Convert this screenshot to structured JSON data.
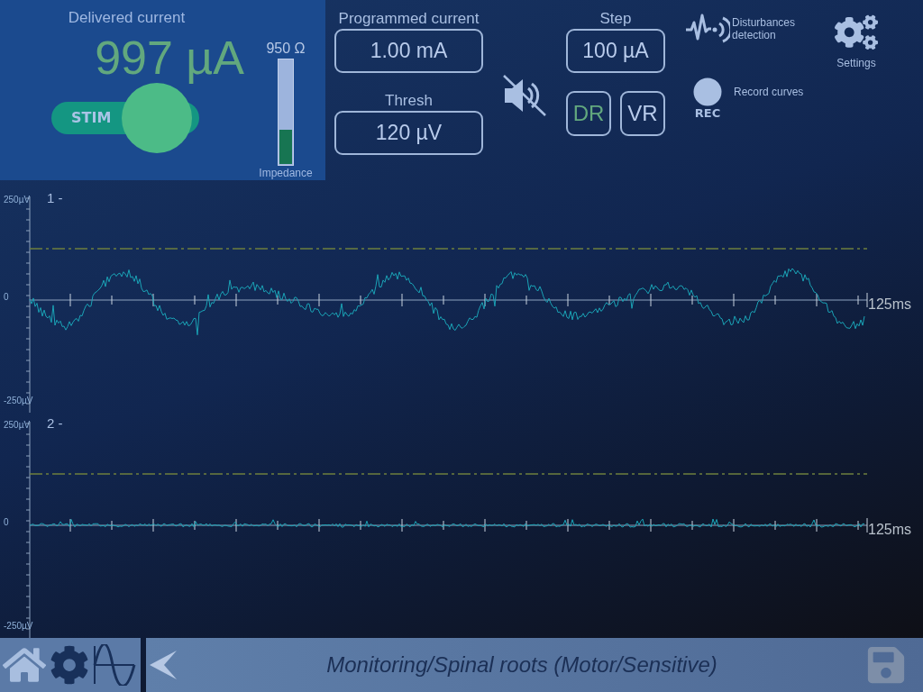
{
  "delivered": {
    "label": "Delivered current",
    "value": "997 µA"
  },
  "stim": {
    "label": "STIM",
    "on": true
  },
  "impedance": {
    "reading": "950 Ω",
    "level": 0.33,
    "label": "Impedance"
  },
  "programmed": {
    "label": "Programmed current",
    "value": "1.00 mA"
  },
  "thresh": {
    "label": "Thresh",
    "value": "120 µV"
  },
  "sound": {
    "muted": true
  },
  "step": {
    "label": "Step",
    "value": "100 µA"
  },
  "modes": [
    {
      "label": "DR",
      "selected": true
    },
    {
      "label": "VR",
      "selected": false
    }
  ],
  "disturbances": {
    "label": "Disturbances detection"
  },
  "record": {
    "icon_label": "REC",
    "label": "Record curves"
  },
  "settings": {
    "label": "Settings"
  },
  "channels": [
    {
      "label": "1 -",
      "top": "250µV",
      "zero": "0",
      "bottom": "-250µV",
      "time": "125ms"
    },
    {
      "label": "2 -",
      "top": "250µV",
      "zero": "0",
      "bottom": "-250µV",
      "time": "125ms"
    }
  ],
  "footer": {
    "title": "Monitoring/Spinal roots (Motor/Sensitive)"
  }
}
